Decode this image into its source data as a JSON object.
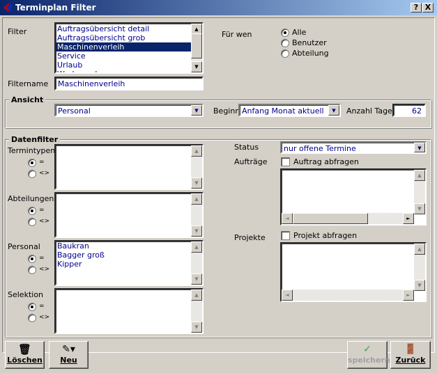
{
  "window": {
    "title": "Terminplan Filter",
    "help_label": "?",
    "close_label": "X"
  },
  "filter": {
    "label": "Filter",
    "items": [
      "Auftragsübersicht detail",
      "Auftragsübersicht grob",
      "Maschinenverleih",
      "Service",
      "Urlaub",
      "Werkzeugbau"
    ],
    "selected": "Maschinenverleih"
  },
  "fuer_wen": {
    "label": "Für wen",
    "options": [
      "Alle",
      "Benutzer",
      "Abteilung"
    ],
    "selected": "Alle"
  },
  "filtername": {
    "label": "Filtername",
    "value": "Maschinenverleih"
  },
  "ansicht": {
    "title": "Ansicht",
    "view_value": "Personal",
    "beginn_label": "Beginn",
    "beginn_value": "Anfang Monat aktuell",
    "anzahl_label": "Anzahl Tage",
    "anzahl_value": "62"
  },
  "datenfilter": {
    "title": "Datenfilter",
    "eq": "=",
    "neq": "<>",
    "termintypen": {
      "label": "Termintypen",
      "items": []
    },
    "abteilungen": {
      "label": "Abteilungen",
      "items": []
    },
    "personal": {
      "label": "Personal",
      "items": [
        "Baukran",
        "Bagger groß",
        "Kipper"
      ]
    },
    "selektion": {
      "label": "Selektion",
      "items": []
    },
    "status_label": "Status",
    "status_value": "nur offene Termine",
    "auftraege_label": "Aufträge",
    "auftrag_check_label": "Auftrag abfragen",
    "projekte_label": "Projekte",
    "projekt_check_label": "Projekt abfragen"
  },
  "buttons": {
    "loeschen": "Löschen",
    "neu": "Neu",
    "speichern": "speichern",
    "zurueck": "Zurück"
  }
}
